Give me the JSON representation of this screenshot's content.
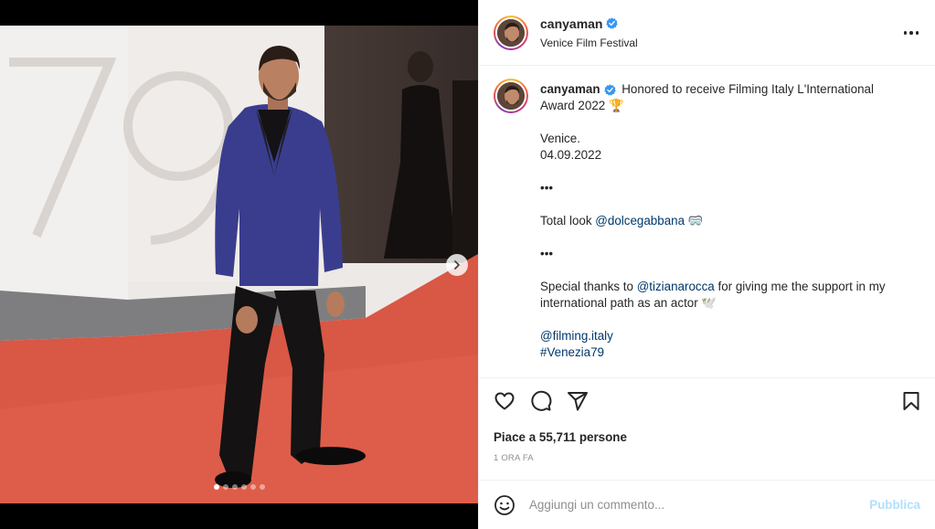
{
  "post": {
    "username": "canyaman",
    "location": "Venice Film Festival",
    "carousel": {
      "slide_count": 6,
      "active_index": 0
    }
  },
  "caption": {
    "username": "canyaman",
    "line1": "Honored to receive Filming Italy L'International Award 2022 🏆",
    "line2": "Venice.",
    "line3": "04.09.2022",
    "sep1": "•••",
    "total_look_prefix": "Total look ",
    "total_look_mention": "@dolcegabbana",
    "total_look_emoji": "🥽",
    "sep2": "•••",
    "thanks_prefix": "Special thanks to ",
    "thanks_mention": "@tizianarocca",
    "thanks_suffix": " for giving me the support in my international path as an actor 🕊️",
    "mention_filming": "@filming.italy",
    "hashtag": "#Venezia79"
  },
  "stats": {
    "likes_text": "Piace a 55,711 persone",
    "time_ago": "1 ORA FA"
  },
  "comment": {
    "placeholder": "Aggiungi un commento...",
    "post_label": "Pubblica"
  },
  "icons": {
    "verified": "verified-badge-icon",
    "more": "more-options-icon",
    "like": "heart-icon",
    "comment": "comment-bubble-icon",
    "share": "paper-plane-icon",
    "save": "bookmark-icon",
    "emoji": "smiley-icon",
    "next": "chevron-right-icon"
  },
  "colors": {
    "verified": "#3897f0",
    "link": "#00376b",
    "muted": "#8e8e8e",
    "post_button_disabled": "#b2dffc"
  }
}
